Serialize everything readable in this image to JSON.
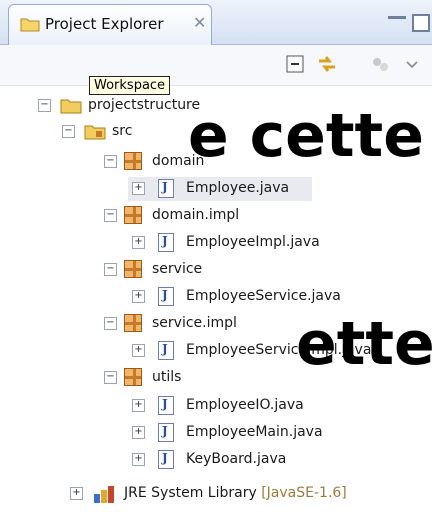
{
  "tab": {
    "title": "Project Explorer",
    "close": "✕"
  },
  "tooltip": "Workspace",
  "overlay": {
    "line1": "e cette",
    "line2": "ette"
  },
  "tree": {
    "project": "projectstructure",
    "folder": "src",
    "items": [
      {
        "kind": "package",
        "label": "domain"
      },
      {
        "kind": "file",
        "label": "Employee.java"
      },
      {
        "kind": "package",
        "label": "domain.impl"
      },
      {
        "kind": "file",
        "label": "EmployeeImpl.java"
      },
      {
        "kind": "package",
        "label": "service"
      },
      {
        "kind": "file",
        "label": "EmployeeService.java"
      },
      {
        "kind": "package",
        "label": "service.impl"
      },
      {
        "kind": "file",
        "label": "EmployeeServiceImpl.java"
      },
      {
        "kind": "package",
        "label": "utils"
      },
      {
        "kind": "file",
        "label": "EmployeeIO.java"
      },
      {
        "kind": "file",
        "label": "EmployeeMain.java"
      },
      {
        "kind": "file",
        "label": "KeyBoard.java"
      }
    ],
    "library": {
      "label": "JRE System Library",
      "detail": "[JavaSE-1.6]"
    }
  },
  "colors": {
    "tab_bg": "#dbe5f4",
    "tooltip_bg": "#ffffe1",
    "package": "#f3b56a",
    "selection": "#e8eaf0"
  }
}
